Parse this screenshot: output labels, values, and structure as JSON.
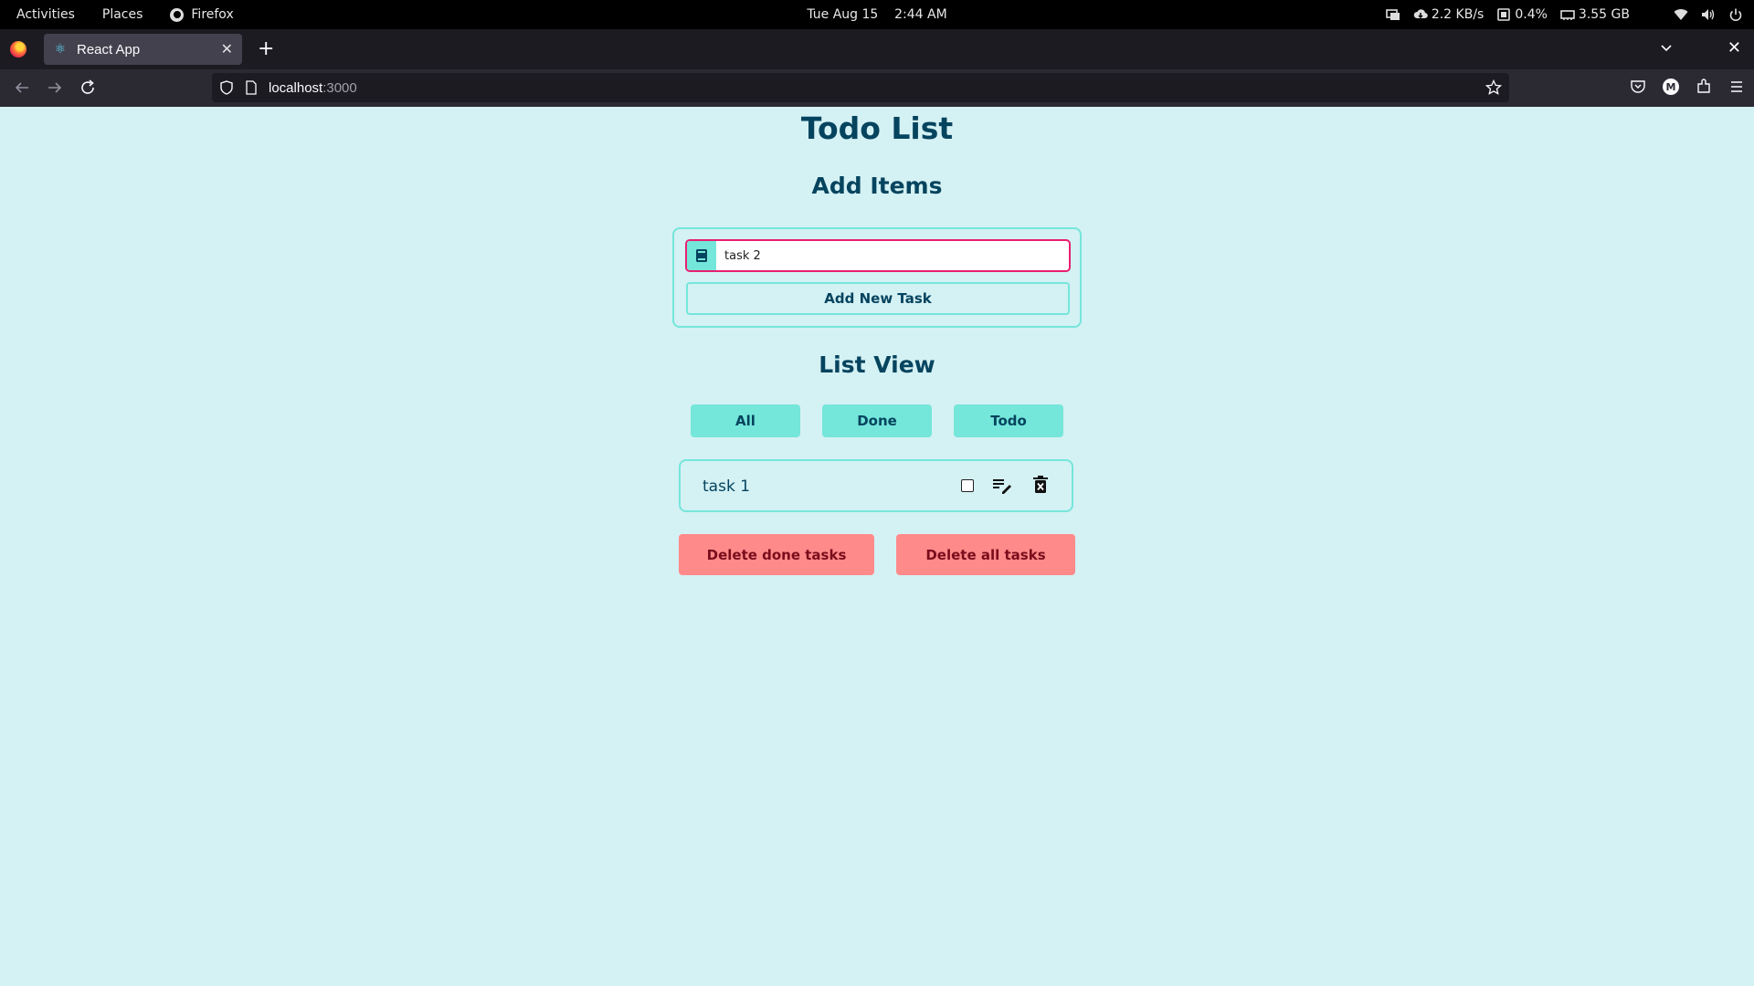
{
  "system_bar": {
    "activities": "Activities",
    "places": "Places",
    "app_name": "Firefox",
    "date": "Tue Aug 15",
    "time": "2:44 AM",
    "net_speed": "2.2 KB/s",
    "cpu": "0.4%",
    "memory": "3.55 GB"
  },
  "browser": {
    "tab_title": "React App",
    "url_host": "localhost",
    "url_port": ":3000"
  },
  "app": {
    "title": "Todo List",
    "add_heading": "Add Items",
    "input_value": "task 2",
    "add_button": "Add New Task",
    "list_heading": "List View",
    "filters": [
      "All",
      "Done",
      "Todo"
    ],
    "tasks": [
      {
        "text": "task 1",
        "done": false
      }
    ],
    "delete_done": "Delete done tasks",
    "delete_all": "Delete all tasks"
  },
  "colors": {
    "page_bg": "#d4f1f4",
    "accent": "#75e6da",
    "heading": "#05445e",
    "input_border": "#e81f6f",
    "danger_bg": "#ff8a8a"
  }
}
